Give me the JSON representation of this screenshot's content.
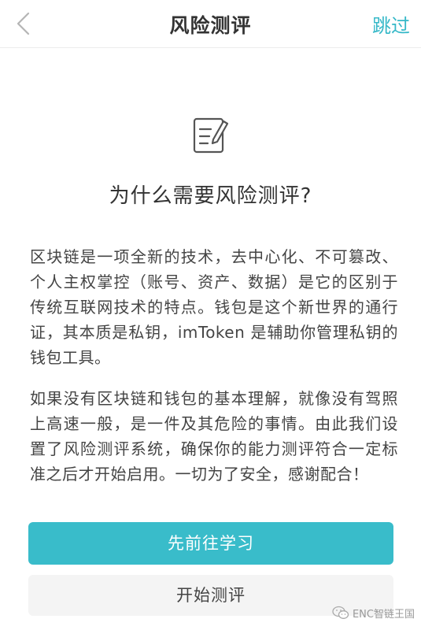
{
  "nav": {
    "title": "风险测评",
    "skip_label": "跳过",
    "back_icon": "chevron-left-icon"
  },
  "hero": {
    "icon": "edit-document-icon",
    "heading": "为什么需要风险测评?"
  },
  "body": {
    "paragraph1": "区块链是一项全新的技术，去中心化、不可篡改、个人主权掌控（账号、资产、数据）是它的区别于传统互联网技术的特点。钱包是这个新世界的通行证，其本质是私钥，imToken 是辅助你管理私钥的钱包工具。",
    "paragraph2": "如果没有区块链和钱包的基本理解，就像没有驾照上高速一般，是一件及其危险的事情。由此我们设置了风险测评系统，确保你的能力测评符合一定标准之后才开始启用。一切为了安全，感谢配合！"
  },
  "actions": {
    "learn_label": "先前往学习",
    "start_label": "开始测评"
  },
  "watermark": {
    "text": "ENC智链王国",
    "icon": "wechat-icon"
  },
  "colors": {
    "accent": "#39bcca",
    "skip": "#35b8c8",
    "secondary_bg": "#f4f4f4"
  }
}
